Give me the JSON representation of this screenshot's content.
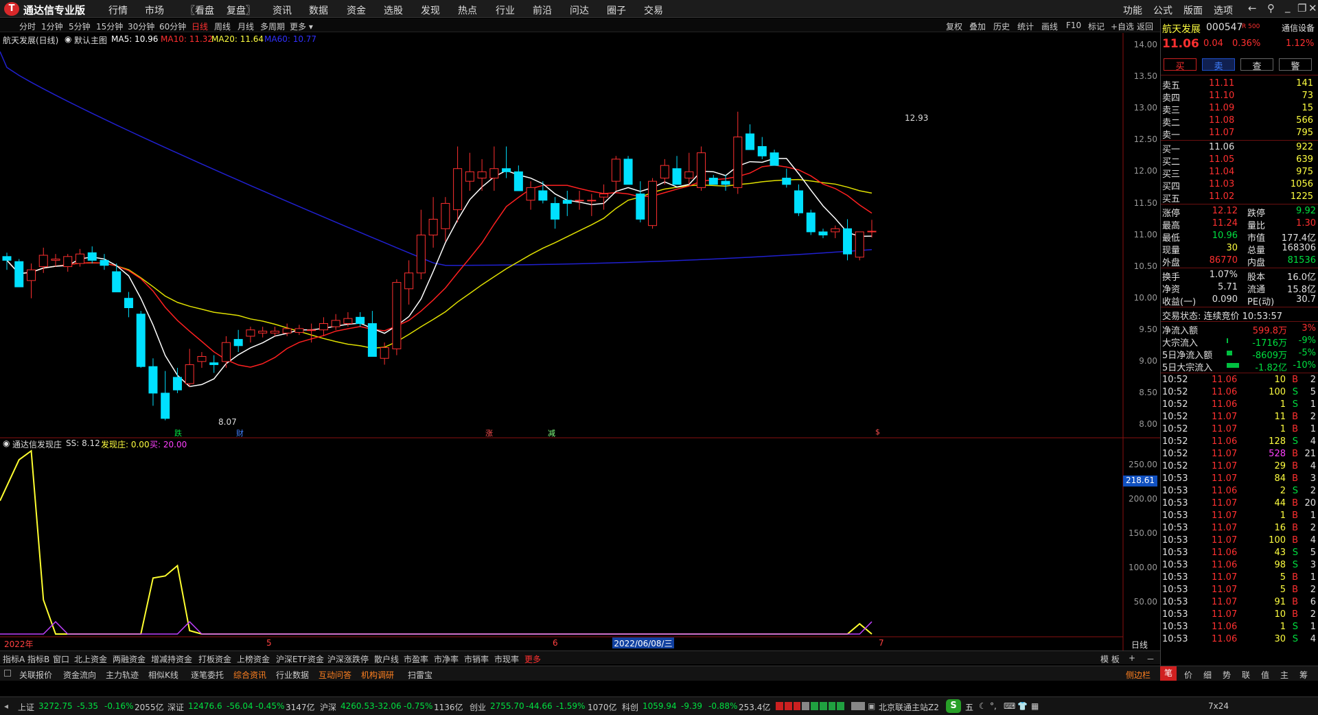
{
  "app": {
    "title": "通达信专业版",
    "logo": "T"
  },
  "menu": [
    "行情",
    "市场",
    "〖看盘",
    "复盘〗",
    "资讯",
    "数据",
    "资金",
    "选股",
    "发现",
    "热点",
    "行业",
    "前沿",
    "问达",
    "圈子",
    "交易"
  ],
  "right_menu": [
    "功能",
    "公式",
    "版面",
    "选项"
  ],
  "periods": [
    "分时",
    "1分钟",
    "5分钟",
    "15分钟",
    "30分钟",
    "60分钟",
    "日线",
    "周线",
    "月线",
    "多周期",
    "更多 ▾"
  ],
  "active_period": "日线",
  "chart_tools": [
    "复权",
    "叠加",
    "历史",
    "统计",
    "画线",
    "F10",
    "标记",
    "+自选",
    "返回"
  ],
  "main_chart": {
    "stock_label": "航天发展(日线)",
    "template": "默认主图",
    "ma5": "MA5: 10.96",
    "ma10": "MA10: 11.32",
    "ma20": "MA20: 11.64",
    "ma60": "MA60: 10.77",
    "high_label": "12.93",
    "low_label": "8.07",
    "y_ticks": [
      "14.00",
      "13.50",
      "13.00",
      "12.50",
      "12.00",
      "11.50",
      "11.00",
      "10.50",
      "10.00",
      "9.50",
      "9.00",
      "8.50",
      "8.00"
    ],
    "markers": [
      "跌",
      "财",
      "涨",
      "减",
      "$"
    ],
    "colors": {
      "up": "#ff3030",
      "down": "#00e0ff",
      "ma5": "#ffffff",
      "ma10": "#ff2020",
      "ma20": "#e0e000",
      "ma60": "#2020d0"
    }
  },
  "sub_chart": {
    "indicator": "通达信发现庄",
    "ss": "SS: 8.12",
    "fxz": "发现庄: 0.00",
    "buy": "买: 20.00",
    "y_ticks": [
      "250.00",
      "200.00",
      "150.00",
      "100.00",
      "50.00"
    ],
    "cursor_value": "218.61"
  },
  "x_axis": {
    "labels": [
      "2022年",
      "5",
      "6",
      "7"
    ],
    "cursor_date": "2022/06/08/三",
    "period": "日线"
  },
  "chart_data": {
    "type": "candlestick",
    "ylim": [
      8.0,
      14.0
    ],
    "high": 12.93,
    "low": 8.07,
    "ma_values": {
      "MA5": 10.96,
      "MA10": 11.32,
      "MA20": 11.64,
      "MA60": 10.77
    },
    "sub_ylim": [
      0,
      270
    ]
  },
  "quote": {
    "name": "航天发展",
    "code": "000547",
    "badge": "R 500",
    "settings": "通信设备",
    "price": "11.06",
    "change": "0.04",
    "pct": "0.36%",
    "pct2": "1.12%",
    "buttons": [
      "买",
      "卖",
      "查",
      "警"
    ],
    "sells": [
      [
        "卖五",
        "11.11",
        "141"
      ],
      [
        "卖四",
        "11.10",
        "73"
      ],
      [
        "卖三",
        "11.09",
        "15"
      ],
      [
        "卖二",
        "11.08",
        "566"
      ],
      [
        "卖一",
        "11.07",
        "795"
      ]
    ],
    "buys": [
      [
        "买一",
        "11.06",
        "922"
      ],
      [
        "买二",
        "11.05",
        "639"
      ],
      [
        "买三",
        "11.04",
        "975"
      ],
      [
        "买四",
        "11.03",
        "1056"
      ],
      [
        "买五",
        "11.02",
        "1225"
      ]
    ],
    "stats": [
      [
        "涨停",
        "12.12",
        "跌停",
        "9.92"
      ],
      [
        "最高",
        "11.24",
        "量比",
        "1.30"
      ],
      [
        "最低",
        "10.96",
        "市值",
        "177.4亿"
      ],
      [
        "现量",
        "30",
        "总量",
        "168306"
      ],
      [
        "外盘",
        "86770",
        "内盘",
        "81536"
      ]
    ],
    "stats2": [
      [
        "换手",
        "1.07%",
        "股本",
        "16.0亿"
      ],
      [
        "净资",
        "5.71",
        "流通",
        "15.8亿"
      ],
      [
        "收益(一)",
        "0.090",
        "PE(动)",
        "30.7"
      ]
    ],
    "trade_status": "交易状态: 连续竞价 10:53:57",
    "flows": [
      [
        "净流入额",
        "599.8万",
        "3%"
      ],
      [
        "大宗流入",
        "-1716万",
        "-9%"
      ],
      [
        "5日净流入额",
        "-8609万",
        "-5%"
      ],
      [
        "5日大宗流入",
        "-1.82亿",
        "-10%"
      ]
    ],
    "ticks": [
      [
        "10:52",
        "11.06",
        "10",
        "B",
        "2"
      ],
      [
        "10:52",
        "11.06",
        "100",
        "S",
        "5"
      ],
      [
        "10:52",
        "11.06",
        "1",
        "S",
        "1"
      ],
      [
        "10:52",
        "11.07",
        "11",
        "B",
        "2"
      ],
      [
        "10:52",
        "11.07",
        "1",
        "B",
        "1"
      ],
      [
        "10:52",
        "11.06",
        "128",
        "S",
        "4"
      ],
      [
        "10:52",
        "11.07",
        "528",
        "B",
        "21"
      ],
      [
        "10:52",
        "11.07",
        "29",
        "B",
        "4"
      ],
      [
        "10:53",
        "11.07",
        "84",
        "B",
        "3"
      ],
      [
        "10:53",
        "11.06",
        "2",
        "S",
        "2"
      ],
      [
        "10:53",
        "11.07",
        "44",
        "B",
        "20"
      ],
      [
        "10:53",
        "11.07",
        "1",
        "B",
        "1"
      ],
      [
        "10:53",
        "11.07",
        "16",
        "B",
        "2"
      ],
      [
        "10:53",
        "11.07",
        "100",
        "B",
        "4"
      ],
      [
        "10:53",
        "11.06",
        "43",
        "S",
        "5"
      ],
      [
        "10:53",
        "11.06",
        "98",
        "S",
        "3"
      ],
      [
        "10:53",
        "11.07",
        "5",
        "B",
        "1"
      ],
      [
        "10:53",
        "11.07",
        "5",
        "B",
        "2"
      ],
      [
        "10:53",
        "11.07",
        "91",
        "B",
        "6"
      ],
      [
        "10:53",
        "11.07",
        "10",
        "B",
        "2"
      ],
      [
        "10:53",
        "11.06",
        "1",
        "S",
        "1"
      ],
      [
        "10:53",
        "11.06",
        "30",
        "S",
        "4"
      ]
    ],
    "bottom_tabs": [
      "笔",
      "价",
      "细",
      "势",
      "联",
      "值",
      "主",
      "筹"
    ]
  },
  "bottom_tabs1": [
    "指标A",
    "指标B",
    "窗口",
    "北上资金",
    "两融资金",
    "增减持资金",
    "打板资金",
    "上榜资金",
    "沪深ETF资金",
    "沪深涨跌停",
    "散户线",
    "市盈率",
    "市净率",
    "市销率",
    "市现率",
    "更多"
  ],
  "bottom_tabs1_right": [
    "模 板",
    "+",
    "－"
  ],
  "bottom_tabs2": [
    "关联报价",
    "资金流向",
    "主力轨迹",
    "相似K线",
    "逐笔委托",
    "综合资讯",
    "行业数据",
    "互动问答",
    "机构调研",
    "扫雷宝"
  ],
  "bottom_tabs2_right": "侧边栏",
  "status": {
    "sh": [
      "上证",
      "3272.75",
      "-5.35",
      "-0.16%",
      "2055亿"
    ],
    "sz": [
      "深证",
      "12476.6",
      "-56.04",
      "-0.45%",
      "3147亿"
    ],
    "hs": [
      "沪深",
      "4260.53",
      "-32.06",
      "-0.75%",
      "1136亿"
    ],
    "cy": [
      "创业",
      "2755.70",
      "-44.66",
      "-1.59%",
      "1070亿"
    ],
    "kc": [
      "科创",
      "1059.94",
      "-9.39",
      "-0.88%",
      "253.4亿"
    ],
    "server": "北京联通主站Z2",
    "ime": "五",
    "clock": "7x24"
  }
}
